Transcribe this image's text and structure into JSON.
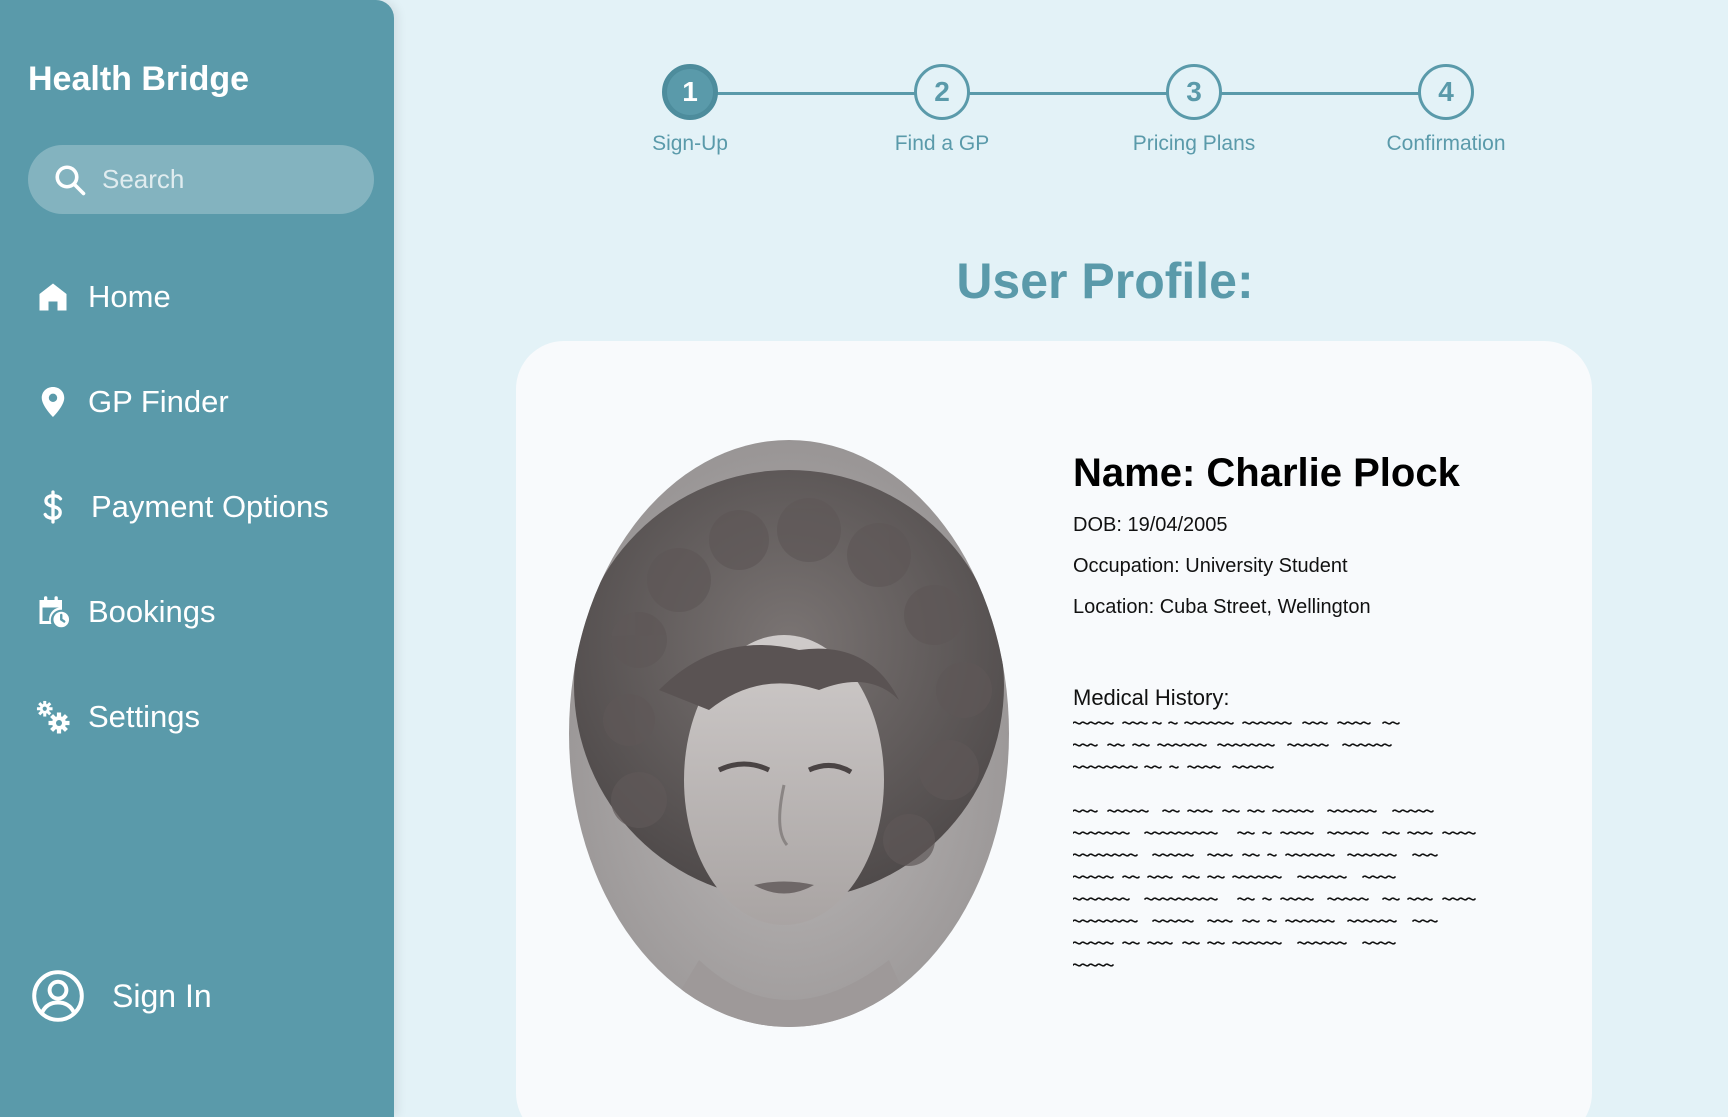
{
  "app": {
    "brand": "Health Bridge"
  },
  "search": {
    "placeholder": "Search"
  },
  "sidebar": {
    "items": [
      {
        "label": "Home",
        "icon": "home-icon"
      },
      {
        "label": "GP Finder",
        "icon": "location-pin-icon"
      },
      {
        "label": "Payment Options",
        "icon": "dollar-icon"
      },
      {
        "label": "Bookings",
        "icon": "calendar-clock-icon"
      },
      {
        "label": "Settings",
        "icon": "gears-icon"
      }
    ],
    "sign_in": {
      "label": "Sign In",
      "icon": "user-circle-icon"
    }
  },
  "stepper": {
    "steps": [
      {
        "number": "1",
        "label": "Sign-Up",
        "active": true
      },
      {
        "number": "2",
        "label": "Find a GP",
        "active": false
      },
      {
        "number": "3",
        "label": "Pricing Plans",
        "active": false
      },
      {
        "number": "4",
        "label": "Confirmation",
        "active": false
      }
    ]
  },
  "profile": {
    "title": "User Profile:",
    "name": "Name: Charlie Plock",
    "dob": "DOB: 19/04/2005",
    "occupation": "Occupation: University Student",
    "location": "Location: Cuba Street, Wellington",
    "medical_history_title": "Medical History:"
  },
  "colors": {
    "background": "#e3f2f7",
    "sidebar": "#5a9aaa",
    "accent": "#5a9aaa",
    "card": "#f8fafc"
  }
}
